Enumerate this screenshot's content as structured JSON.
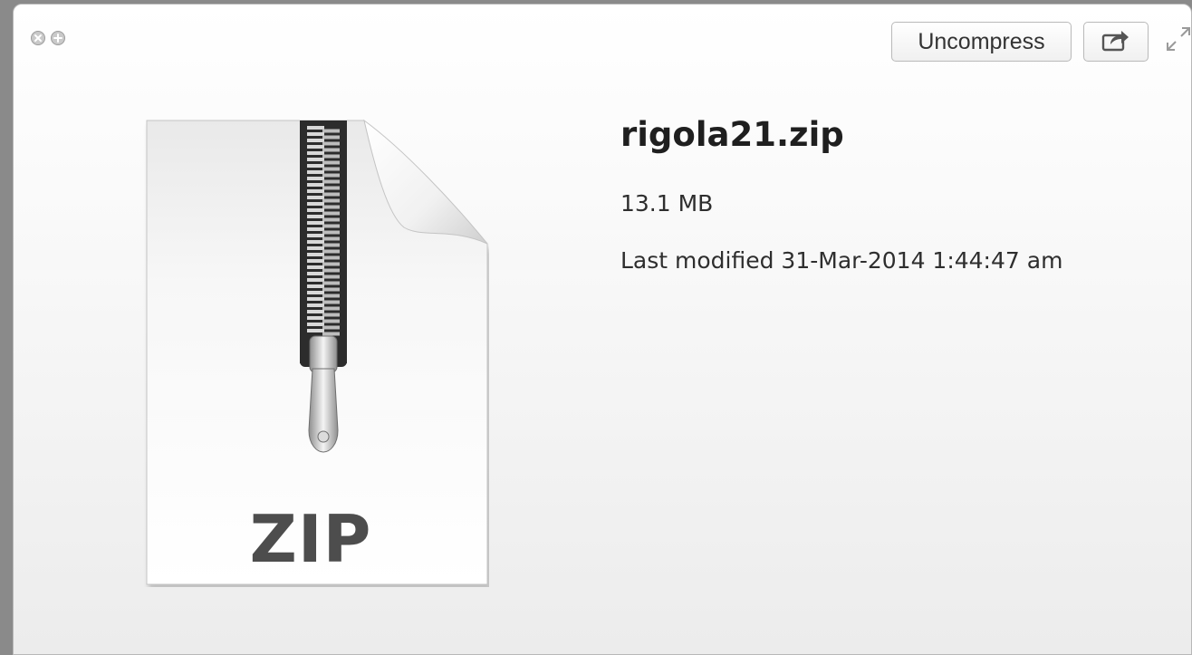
{
  "window": {
    "controls": {
      "close_icon": "close-icon",
      "zoom_icon": "zoom-plus-icon"
    },
    "toolbar": {
      "uncompress_label": "Uncompress",
      "share_icon": "share-icon",
      "fullscreen_icon": "fullscreen-icon"
    }
  },
  "file": {
    "icon_label": "ZIP",
    "name": "rigola21.zip",
    "size": "13.1 MB",
    "modified": "Last modified 31-Mar-2014 1:44:47 am"
  },
  "colors": {
    "window_bg": "#f7f7f7",
    "text": "#2e2e2e",
    "zip_label": "#4d4d4d"
  }
}
